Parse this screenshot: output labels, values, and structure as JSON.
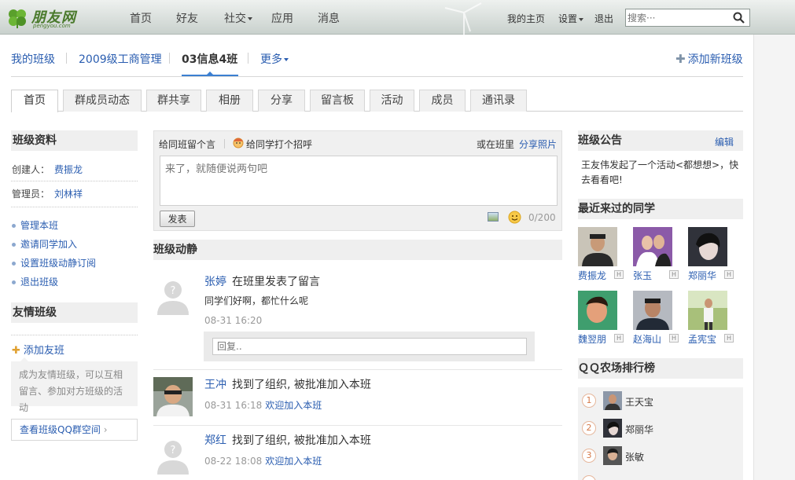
{
  "header": {
    "logo_text": "朋友网",
    "logo_sub": "pengyou.com",
    "nav": [
      "首页",
      "好友",
      "社交",
      "应用",
      "消息"
    ],
    "my_home": "我的主页",
    "settings": "设置",
    "logout": "退出",
    "search_placeholder": "搜索···"
  },
  "class_tabs": {
    "my_class": "我的班级",
    "items": [
      "2009级工商管理",
      "03信息4班"
    ],
    "more": "更多",
    "add_class": "添加新班级"
  },
  "sub_tabs": [
    "首页",
    "群成员动态",
    "群共享",
    "相册",
    "分享",
    "留言板",
    "活动",
    "成员",
    "通讯录"
  ],
  "left": {
    "profile_title": "班级资料",
    "creator_label": "创建人：",
    "creator": "费振龙",
    "admin_label": "管理员：",
    "admin": "刘林祥",
    "links": [
      "管理本班",
      "邀请同学加入",
      "设置班级动静订阅",
      "退出班级"
    ],
    "friends_title": "友情班级",
    "add_friend": "添加友班",
    "friend_note": "成为友情班级，可以互相留言、参加对方班级的活动",
    "qq_space": "查看班级QQ群空间"
  },
  "composer": {
    "tab_message": "给同班留个言",
    "tab_greet": "给同学打个招呼",
    "share_prefix": "或在班里",
    "share_photo": "分享照片",
    "placeholder": "来了，就随便说两句吧",
    "post": "发表",
    "counter": "0/200"
  },
  "feed": {
    "title": "班级动静",
    "items": [
      {
        "name": "张婷",
        "action": "在班里发表了留言",
        "body": "同学们好啊，都忙什么呢",
        "time": "08-31 16:20",
        "welcome": ""
      },
      {
        "name": "王冲",
        "action": "找到了组织, 被批准加入本班",
        "body": "",
        "time": "08-31 16:18",
        "welcome": "欢迎加入本班"
      },
      {
        "name": "郑红",
        "action": "找到了组织, 被批准加入本班",
        "body": "",
        "time": "08-22 18:08",
        "welcome": "欢迎加入本班"
      }
    ],
    "reply_placeholder": "回复.."
  },
  "right": {
    "notice_title": "班级公告",
    "edit": "编辑",
    "notice": "王友伟发起了一个活动<都想想>，快去看看吧!",
    "recent_title": "最近来过的同学",
    "visitors": [
      "费振龙",
      "张玉",
      "郑丽华",
      "魏翌朋",
      "赵海山",
      "孟宪宝"
    ],
    "farm_title": "ＱＱ农场排行榜",
    "farm": [
      {
        "rank": "1",
        "name": "王天宝"
      },
      {
        "rank": "2",
        "name": "郑丽华"
      },
      {
        "rank": "3",
        "name": "张敏"
      }
    ]
  },
  "colors": {
    "link": "#2a5db0",
    "accent": "#3b7fd1",
    "panel": "#efefef"
  }
}
